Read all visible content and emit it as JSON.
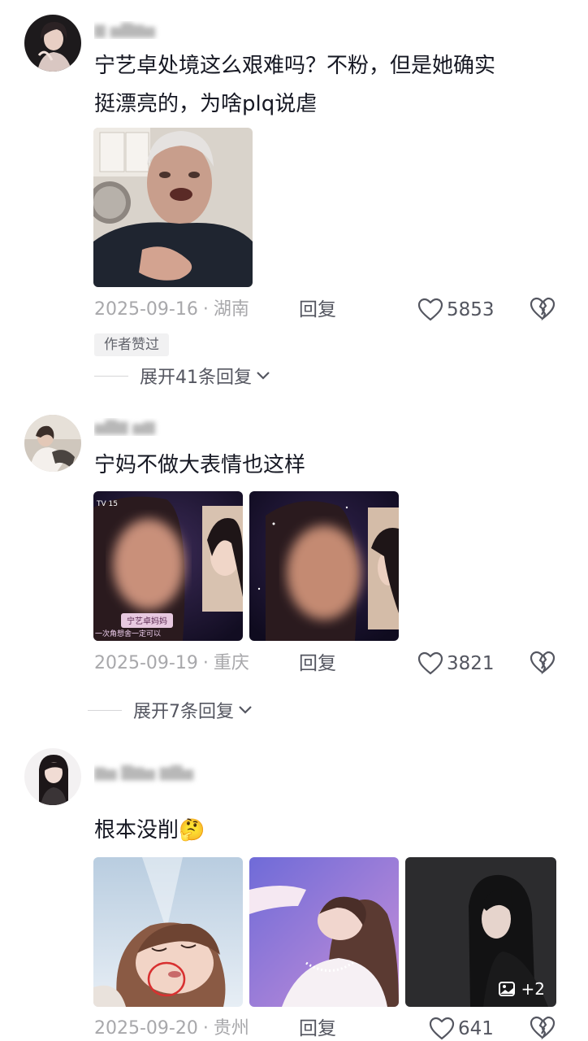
{
  "comments": [
    {
      "text_line1": "宁艺卓处境这么艰难吗？不粉，但是她确实",
      "text_line2": "挺漂亮的，为啥plq说虐",
      "date": "2025-09-16",
      "location": "湖南",
      "reply_label": "回复",
      "likes": "5853",
      "badge": "作者赞过",
      "expand_label": "展开41条回复"
    },
    {
      "text": "宁妈不做大表情也这样",
      "date": "2025-09-19",
      "location": "重庆",
      "reply_label": "回复",
      "likes": "3821",
      "expand_label": "展开7条回复",
      "image1_caption": "宁艺卓妈妈",
      "image1_subtitle": "一次角想舍一定可以",
      "image1_logo": "TV 15"
    },
    {
      "text": "根本没削",
      "emoji": "🤔",
      "date": "2025-09-20",
      "location": "贵州",
      "reply_label": "回复",
      "likes": "641",
      "more_images": "+2"
    }
  ],
  "separator_dot": "·",
  "colors": {
    "text_primary": "#161823",
    "text_meta": "#a8a8ab",
    "text_action": "#545660",
    "badge_bg": "#f1f1f2"
  },
  "icons": [
    "heart-icon",
    "broken-heart-icon",
    "chevron-down-icon",
    "image-icon"
  ]
}
